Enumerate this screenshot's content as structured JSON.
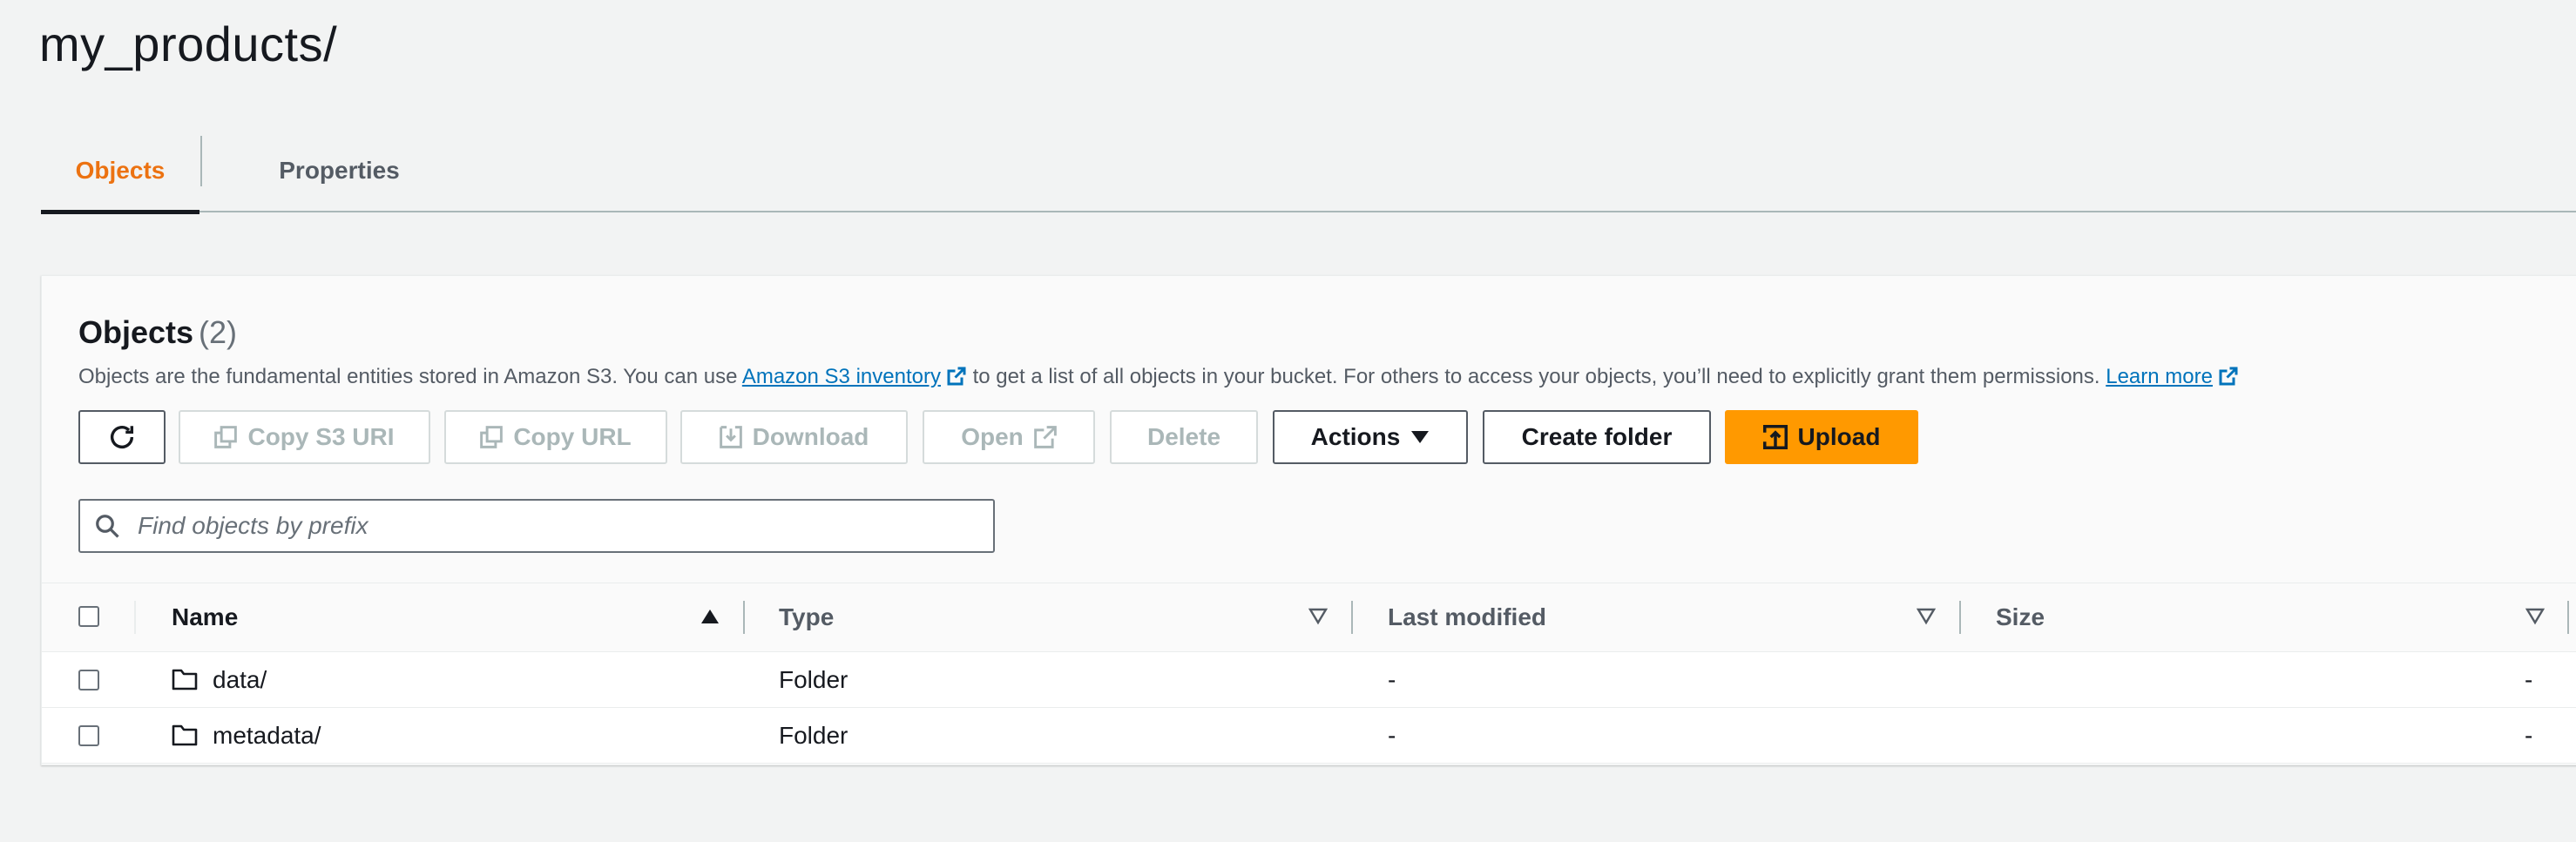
{
  "page": {
    "title": "my_products/"
  },
  "tabs": [
    {
      "label": "Objects",
      "active": true
    },
    {
      "label": "Properties",
      "active": false
    }
  ],
  "objects_panel": {
    "title": "Objects",
    "count": "(2)",
    "description_before": "Objects are the fundamental entities stored in Amazon S3. You can use ",
    "inventory_link": "Amazon S3 inventory",
    "description_middle": " to get a list of all objects in your bucket. For others to access your objects, you’ll need to explicitly grant them permissions. ",
    "learn_more_link": "Learn more"
  },
  "toolbar": {
    "refresh_icon": "refresh-icon",
    "copy_s3_uri": "Copy S3 URI",
    "copy_url": "Copy URL",
    "download": "Download",
    "open": "Open",
    "delete": "Delete",
    "actions": "Actions",
    "create_folder": "Create folder",
    "upload": "Upload"
  },
  "search": {
    "placeholder": "Find objects by prefix",
    "value": ""
  },
  "table": {
    "columns": [
      "Name",
      "Type",
      "Last modified",
      "Size"
    ],
    "sort": {
      "column": "Name",
      "direction": "ascending"
    },
    "rows": [
      {
        "name": "data/",
        "type": "Folder",
        "last_modified": "-",
        "size": "-"
      },
      {
        "name": "metadata/",
        "type": "Folder",
        "last_modified": "-",
        "size": "-"
      }
    ]
  },
  "colors": {
    "accent_orange": "#ec7211",
    "primary_button": "#ff9900",
    "link_blue": "#0073bb",
    "background": "#f2f3f3"
  }
}
